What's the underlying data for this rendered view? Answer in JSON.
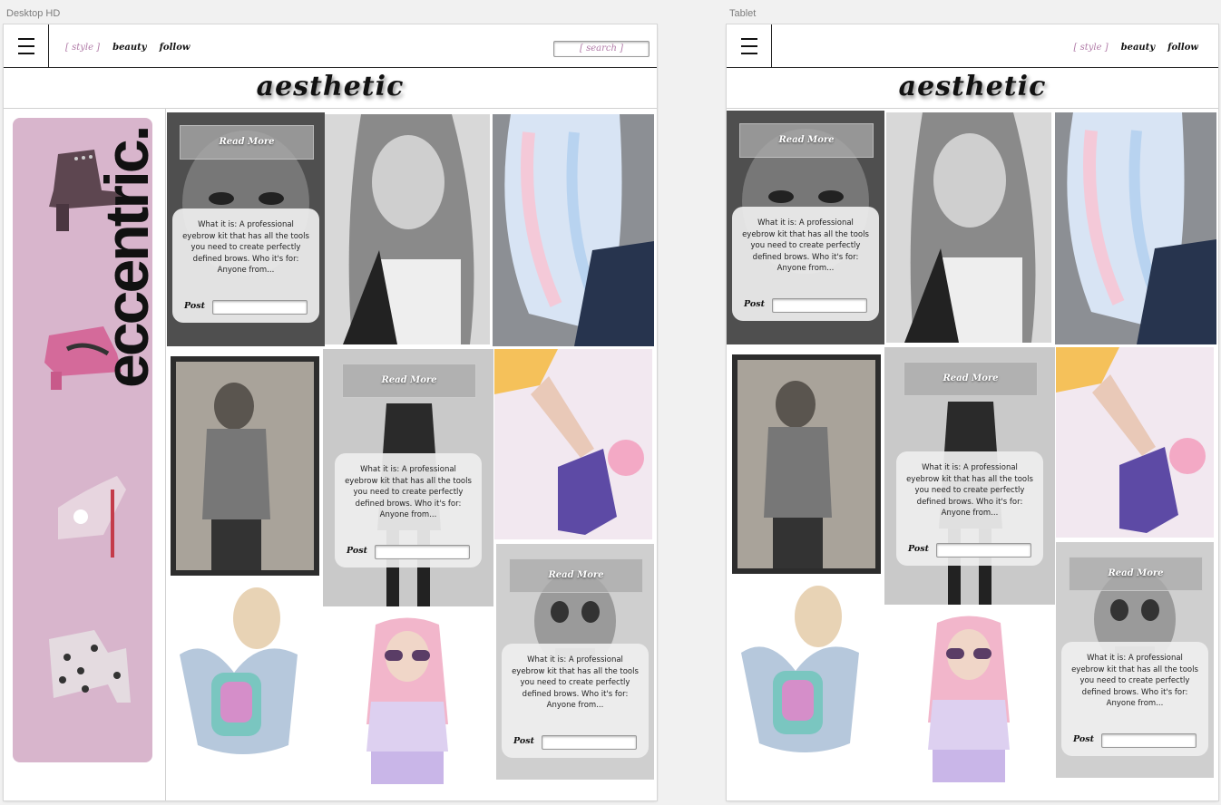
{
  "artboards": {
    "desktop": {
      "label": "Desktop HD",
      "nav": [
        "[ style ]",
        "beauty",
        "follow"
      ],
      "search_placeholder": "[ search ]",
      "brand": "aesthetic",
      "sidebar_text": "eccentric.",
      "cards": [
        {
          "read_more": "Read More",
          "description": "What it is: A professional eyebrow kit that has all the tools you need to create perfectly defined brows. Who it's for: Anyone from...",
          "post_label": "Post"
        },
        {
          "read_more": "Read More",
          "description": "What it is: A professional eyebrow kit that has all the tools you need to create perfectly defined brows. Who it's for: Anyone from...",
          "post_label": "Post"
        },
        {
          "read_more": "Read More",
          "description": "What it is: A professional eyebrow kit that has all the tools you need to create perfectly defined brows. Who it's for: Anyone from...",
          "post_label": "Post"
        }
      ]
    },
    "tablet": {
      "label": "Tablet",
      "nav": [
        "[ style ]",
        "beauty",
        "follow"
      ],
      "brand": "aesthetic",
      "cards": [
        {
          "read_more": "Read More",
          "description": "What it is: A professional eyebrow kit that has all the tools you need to create perfectly defined brows. Who it's for: Anyone from...",
          "post_label": "Post"
        },
        {
          "read_more": "Read More",
          "description": "What it is: A professional eyebrow kit that has all the tools you need to create perfectly defined brows. Who it's for: Anyone from...",
          "post_label": "Post"
        },
        {
          "read_more": "Read More",
          "description": "What it is: A professional eyebrow kit that has all the tools you need to create perfectly defined brows. Who it's for: Anyone from...",
          "post_label": "Post"
        }
      ]
    }
  },
  "colors": {
    "accent_pink": "#b07aa7",
    "sidebar_pink": "#d8b5cc",
    "text_dark": "#111111"
  }
}
